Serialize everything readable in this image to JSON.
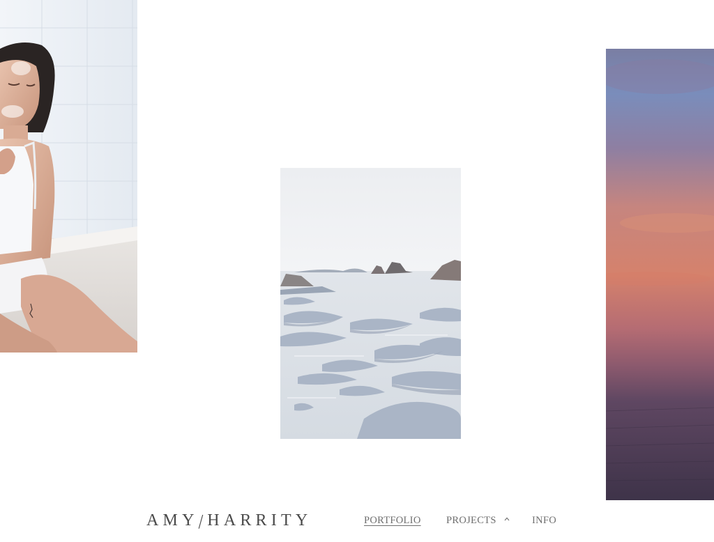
{
  "site": {
    "logo_first": "AMY",
    "logo_slash": "/",
    "logo_last": "HARRITY"
  },
  "nav": {
    "items": [
      {
        "label": "PORTFOLIO",
        "active": true
      },
      {
        "label": "PROJECTS",
        "has_submenu": true,
        "submenu_icon": "chevron-up-icon"
      },
      {
        "label": "INFO"
      }
    ]
  },
  "gallery": {
    "photos": [
      {
        "subject": "woman in white tank top sitting in a bathtub",
        "palette": [
          "#eef2f6",
          "#d9e0e8",
          "#c79a86"
        ]
      },
      {
        "subject": "salt rock formations in still lake water",
        "palette": [
          "#eef0f2",
          "#c4ccd6",
          "#6f7785"
        ]
      },
      {
        "subject": "sunset sky over plain, cropped at right edge",
        "palette": [
          "#6f84b3",
          "#d9866f",
          "#4f3e56"
        ]
      }
    ]
  },
  "colors": {
    "background": "#ffffff",
    "text": "#4a4a4a",
    "nav_text": "#6f6f6f"
  }
}
